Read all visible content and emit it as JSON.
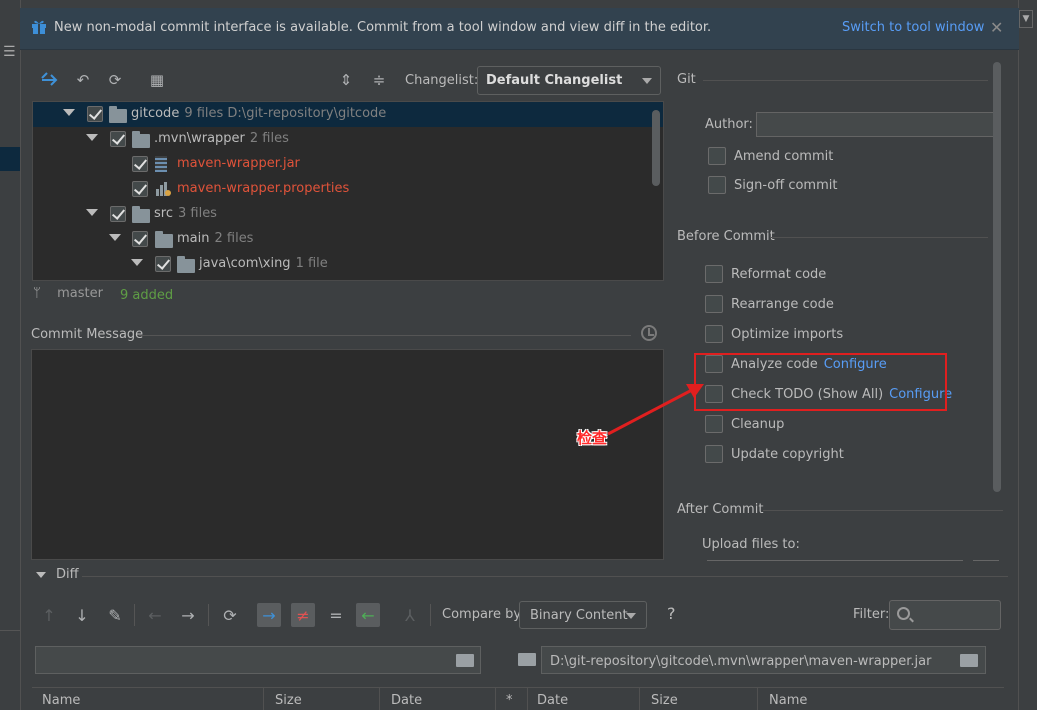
{
  "banner": {
    "message": "New non-modal commit interface is available. Commit from a tool window and view diff in the editor.",
    "link": "Switch to tool window",
    "close": "✕"
  },
  "toolbar": {
    "changelist_label": "Changelist:",
    "changelist_value": "Default Changelist"
  },
  "tree": {
    "rows": [
      {
        "name": "gitcode",
        "meta": "9 files  D:\\git-repository\\gitcode"
      },
      {
        "name": ".mvn\\wrapper",
        "meta": "2 files"
      },
      {
        "name": "maven-wrapper.jar",
        "meta": ""
      },
      {
        "name": "maven-wrapper.properties",
        "meta": ""
      },
      {
        "name": "src",
        "meta": "3 files"
      },
      {
        "name": "main",
        "meta": "2 files"
      },
      {
        "name": "java\\com\\xing",
        "meta": "1 file"
      }
    ]
  },
  "status": {
    "branch": "master",
    "added": "9 added"
  },
  "commit_message": {
    "label": "Commit Message",
    "value": ""
  },
  "git_section": {
    "title": "Git",
    "author_label": "Author:",
    "author_value": "",
    "amend": "Amend commit",
    "signoff": "Sign-off commit"
  },
  "before_commit": {
    "title": "Before Commit",
    "items": [
      {
        "label": "Reformat code",
        "config": ""
      },
      {
        "label": "Rearrange code",
        "config": ""
      },
      {
        "label": "Optimize imports",
        "config": ""
      },
      {
        "label": "Analyze code",
        "config": "Configure"
      },
      {
        "label": "Check TODO (Show All)",
        "config": "Configure"
      },
      {
        "label": "Cleanup",
        "config": ""
      },
      {
        "label": "Update copyright",
        "config": ""
      }
    ]
  },
  "after_commit": {
    "title": "After Commit",
    "upload_label": "Upload files to:"
  },
  "annotation": {
    "text": "检查",
    "color": "#e01f1f"
  },
  "diff": {
    "title": "Diff",
    "compare_label": "Compare by:",
    "compare_value": "Binary Content",
    "help": "?",
    "filter_label": "Filter:",
    "left_path": "",
    "right_path": "D:\\git-repository\\gitcode\\.mvn\\wrapper\\maven-wrapper.jar",
    "columns": [
      "Name",
      "Size",
      "Date",
      "*",
      "Date",
      "Size",
      "Name"
    ]
  },
  "colors": {
    "accent_link": "#589df6",
    "modified_file": "#e0533a",
    "added_status": "#5f9e45",
    "selection": "#0d293e"
  }
}
